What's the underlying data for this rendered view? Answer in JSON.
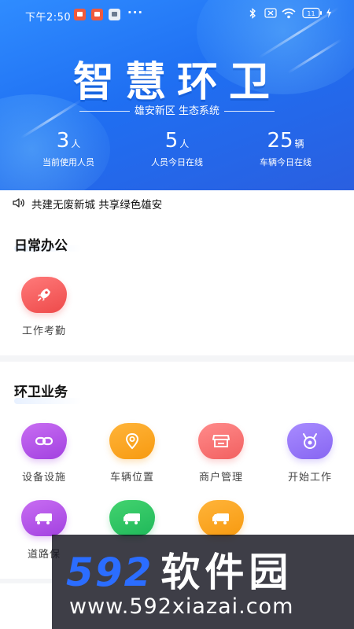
{
  "status_bar": {
    "time": "下午2:50",
    "more": "···",
    "notification_icons": [
      "app-notification-icon",
      "app-notification-icon",
      "app-notification-icon"
    ],
    "system_icons": [
      "bluetooth-icon",
      "sim-icon",
      "wifi-icon",
      "battery-icon",
      "charging-icon"
    ],
    "battery": "11"
  },
  "banner": {
    "title": "智慧环卫",
    "subtitle": "雄安新区 生态系统",
    "stats": [
      {
        "value": "3",
        "unit": "人",
        "caption": "当前使用人员"
      },
      {
        "value": "5",
        "unit": "人",
        "caption": "人员今日在线"
      },
      {
        "value": "25",
        "unit": "辆",
        "caption": "车辆今日在线"
      }
    ]
  },
  "notice": {
    "icon": "speaker-icon",
    "text": "共建无废新城 共享绿色雄安"
  },
  "daily_office": {
    "title": "日常办公",
    "items": [
      {
        "label": "工作考勤",
        "icon": "rocket-icon",
        "color": "#ee4a4a"
      }
    ]
  },
  "sanitation": {
    "title": "环卫业务",
    "items": [
      {
        "label": "设备设施",
        "icon": "link-icon",
        "color": "#a241e0"
      },
      {
        "label": "车辆位置",
        "icon": "location-pin-icon",
        "color": "#f79a10"
      },
      {
        "label": "商户管理",
        "icon": "storefront-icon",
        "color": "#f26060"
      },
      {
        "label": "开始工作",
        "icon": "eye-devil-icon",
        "color": "#8766f2"
      },
      {
        "label": "道路保",
        "icon": "truck-icon",
        "color": "#a241e0"
      },
      {
        "label": "",
        "icon": "truck-icon",
        "color": "#1fb85a"
      },
      {
        "label": "",
        "icon": "truck-icon",
        "color": "#f79a10"
      }
    ]
  },
  "watermark": {
    "brand_digits": "592",
    "brand_text": "软件园",
    "url": "www.592xiazai.com"
  }
}
